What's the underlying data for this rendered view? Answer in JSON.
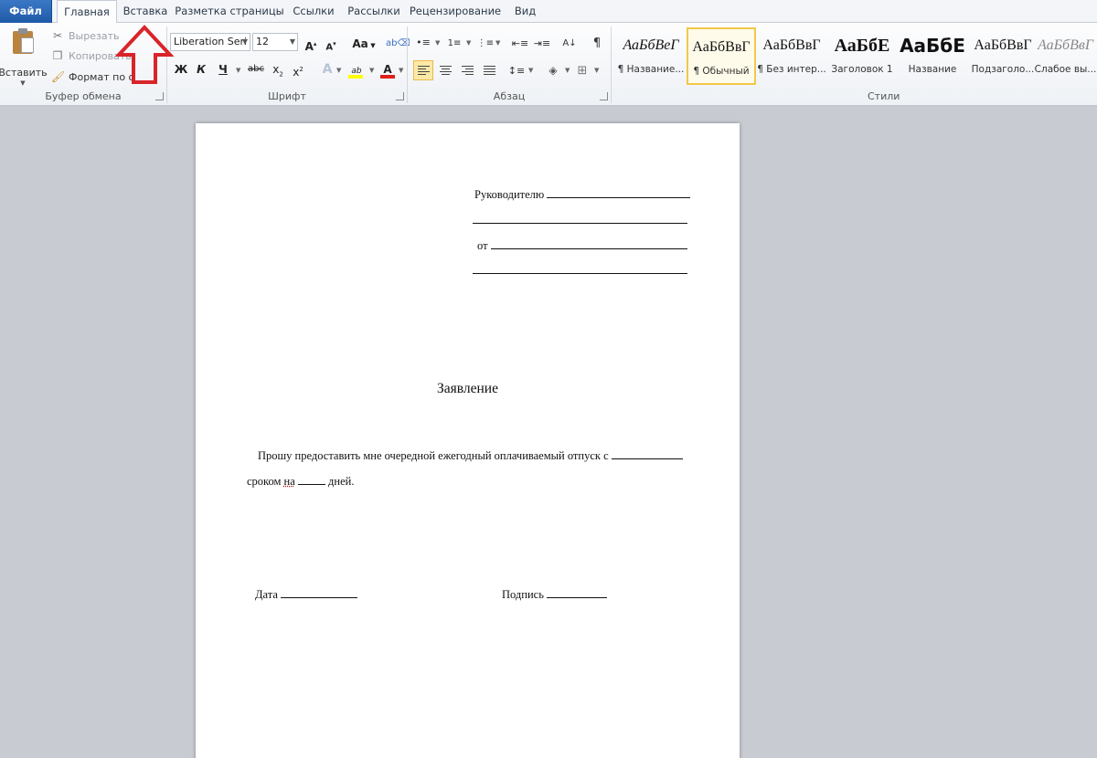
{
  "tabs": {
    "file": "Файл",
    "home": "Главная",
    "insert": "Вставка",
    "layout": "Разметка страницы",
    "references": "Ссылки",
    "mailings": "Рассылки",
    "review": "Рецензирование",
    "view": "Вид"
  },
  "clipboard": {
    "paste": "Вставить",
    "cut": "Вырезать",
    "copy": "Копировать",
    "format_painter": "Формат по о",
    "group_label": "Буфер обмена"
  },
  "font": {
    "name": "Liberation Seri",
    "size": "12",
    "grow": "A",
    "shrink": "A",
    "case": "Aa",
    "bold": "Ж",
    "italic": "К",
    "underline": "Ч",
    "strike": "abc",
    "subscript": "x",
    "superscript": "x",
    "group_label": "Шрифт"
  },
  "paragraph": {
    "show_marks": "¶",
    "group_label": "Абзац"
  },
  "styles": {
    "group_label": "Стили",
    "items": [
      {
        "preview": "АаБбВеГ",
        "name": "¶ Название..."
      },
      {
        "preview": "АаБбВвГ",
        "name": "¶ Обычный"
      },
      {
        "preview": "АаБбВвГ",
        "name": "¶ Без интер..."
      },
      {
        "preview": "АаБбЕ",
        "name": "Заголовок 1"
      },
      {
        "preview": "АаБбЕ",
        "name": "Название"
      },
      {
        "preview": "АаБбВвГ",
        "name": "Подзаголо..."
      },
      {
        "preview": "АаБбВвГ",
        "name": "Слабое вы..."
      }
    ]
  },
  "colors": {
    "highlight": "#ffff00",
    "font_color": "#e0201b",
    "arrow": "#d9242a",
    "file_tab": "#2a66b6"
  },
  "document": {
    "to_label": "Руководителю",
    "from_label": "от",
    "title": "Заявление",
    "body_1": "Прошу предоставить мне очередной ежегодный оплачиваемый отпуск с",
    "body_2a": "сроком",
    "body_2b": "на",
    "body_2c": "дней.",
    "date_label": "Дата",
    "signature_label": "Подпись"
  }
}
